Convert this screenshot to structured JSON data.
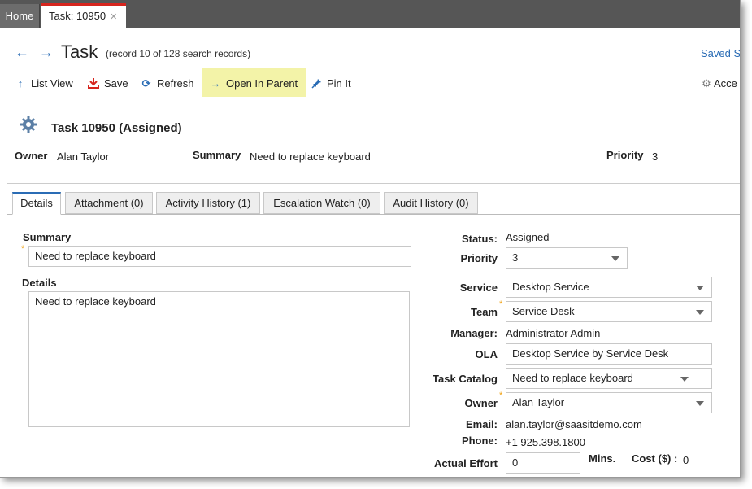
{
  "tabs": {
    "home": "Home",
    "task": "Task: 10950",
    "close": "✕"
  },
  "header": {
    "back_icon": "arrow-left",
    "forward_icon": "arrow-right",
    "title": "Task",
    "subtitle": "(record 10 of 128 search records)",
    "saved_search": "Saved S"
  },
  "toolbar": {
    "list_view": "List View",
    "save": "Save",
    "refresh": "Refresh",
    "open_in_parent": "Open In Parent",
    "pin_it": "Pin It",
    "access": "Acce",
    "highlight_color": "#f3f3a8"
  },
  "record": {
    "title": "Task 10950 (Assigned)",
    "owner_label": "Owner",
    "owner": "Alan Taylor",
    "summary_label": "Summary",
    "summary": "Need to replace keyboard",
    "priority_label": "Priority",
    "priority": "3"
  },
  "detail_tabs": [
    "Details",
    "Attachment (0)",
    "Activity History (1)",
    "Escalation Watch (0)",
    "Audit History (0)"
  ],
  "form": {
    "summary_label": "Summary",
    "summary_value": "Need to replace keyboard",
    "details_label": "Details",
    "details_value": "Need to replace keyboard",
    "required_mark": "*",
    "status_label": "Status:",
    "status_value": "Assigned",
    "priority_label": "Priority",
    "priority_value": "3",
    "service_label": "Service",
    "service_value": "Desktop Service",
    "team_label": "Team",
    "team_value": "Service Desk",
    "manager_label": "Manager:",
    "manager_value": "Administrator Admin",
    "ola_label": "OLA",
    "ola_value": "Desktop Service by Service Desk",
    "task_catalog_label": "Task Catalog",
    "task_catalog_value": "Need to replace keyboard",
    "owner_label": "Owner",
    "owner_value": "Alan Taylor",
    "email_label": "Email:",
    "email_value": "alan.taylor@saasitdemo.com",
    "phone_label": "Phone:",
    "phone_value": "+1 925.398.1800",
    "actual_effort_label": "Actual Effort",
    "actual_effort_value": "0",
    "mins_label": "Mins.",
    "cost_label": "Cost ($) :",
    "cost_value": "0"
  },
  "colors": {
    "accent": "#2a6cb5",
    "tab_bar": "#565656",
    "active_tab_border": "#d6251e",
    "required": "#f0a010"
  }
}
